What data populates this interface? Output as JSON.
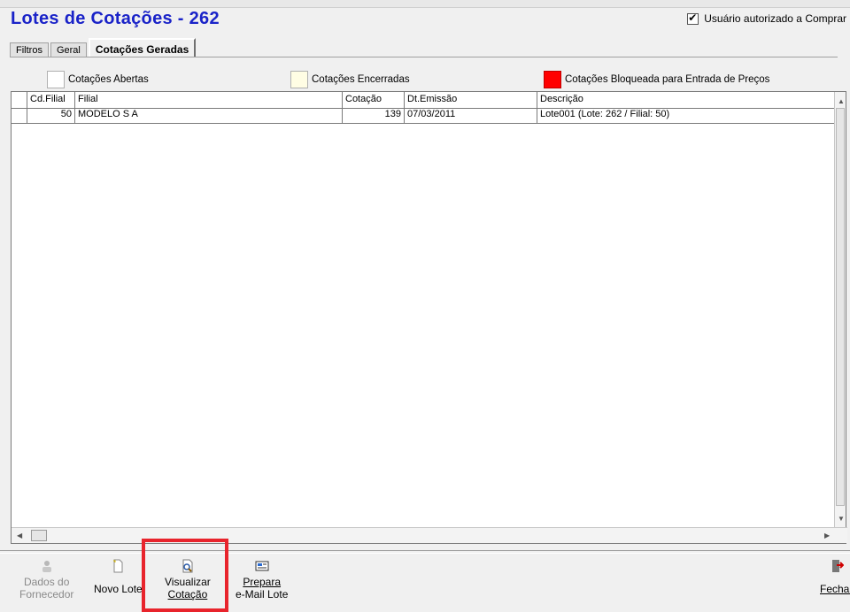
{
  "window": {
    "title": "Lotes de Cotações - 262"
  },
  "authorized": {
    "label": "Usuário autorizado a Comprar",
    "checked": true
  },
  "tabs": [
    {
      "label": "Filtros",
      "active": false
    },
    {
      "label": "Geral",
      "active": false
    },
    {
      "label": "Cotações Geradas",
      "active": true
    }
  ],
  "legend": [
    {
      "label": "Cotações Abertas",
      "color": "#ffffff"
    },
    {
      "label": "Cotações Encerradas",
      "color": "#fffde4"
    },
    {
      "label": "Cotações Bloqueada para Entrada de Preços",
      "color": "#ff0000"
    }
  ],
  "grid": {
    "columns": [
      "Cd.Filial",
      "Filial",
      "Cotação",
      "Dt.Emissão",
      "Descrição"
    ],
    "rows": [
      {
        "cd_filial": "50",
        "filial": "MODELO S A",
        "cotacao": "139",
        "dt_emissao": "07/03/2011",
        "descricao": "Lote001 (Lote: 262 / Filial: 50)"
      }
    ]
  },
  "toolbar": {
    "dados_fornecedor": {
      "line1": "Dados do",
      "line2": "Fornecedor",
      "enabled": false
    },
    "novo_lote": {
      "label": "Novo Lote"
    },
    "visualizar": {
      "line1": "Visualizar",
      "line2": "Cotação"
    },
    "prepara": {
      "line1": "Prepara",
      "line2": "e-Mail Lote"
    },
    "fechar": {
      "label": "Fechar"
    }
  },
  "colors": {
    "title": "#1a23c8",
    "highlight": "#e8242c"
  }
}
